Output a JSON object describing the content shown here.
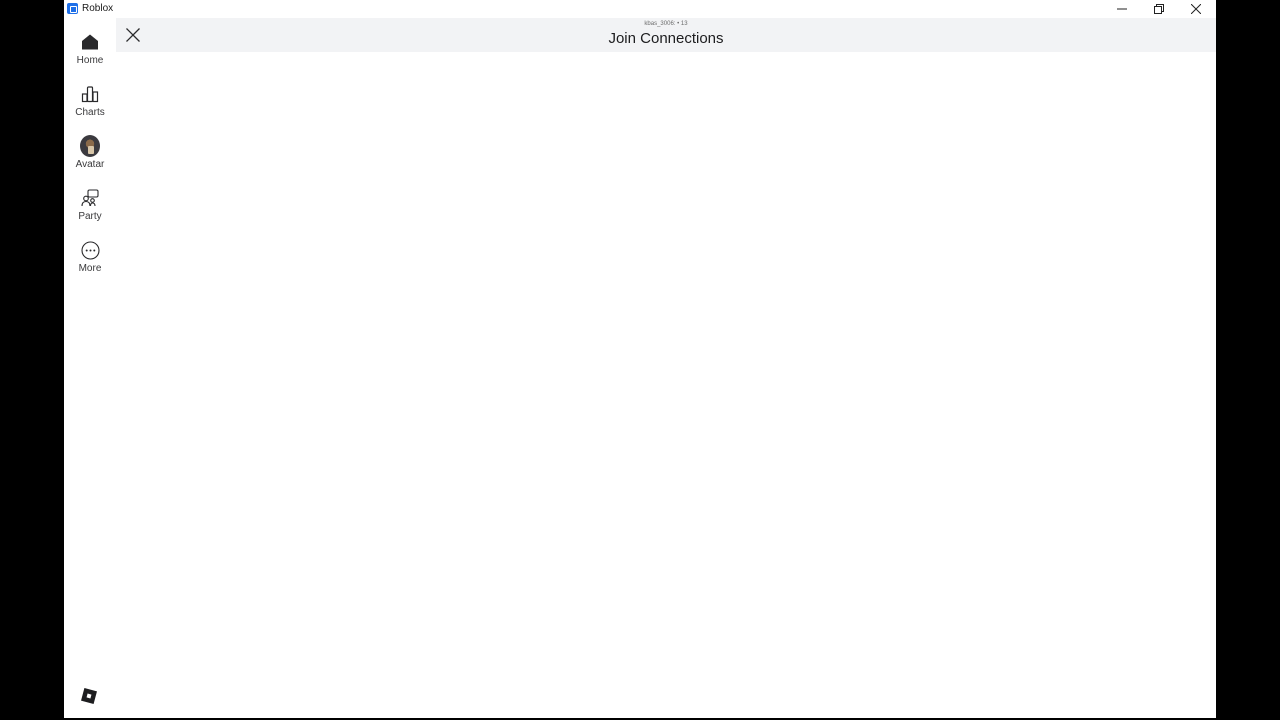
{
  "window": {
    "title": "Roblox"
  },
  "sidebar": {
    "items": [
      {
        "label": "Home",
        "icon": "home-icon"
      },
      {
        "label": "Charts",
        "icon": "charts-icon"
      },
      {
        "label": "Avatar",
        "icon": "avatar-icon"
      },
      {
        "label": "Party",
        "icon": "party-icon"
      },
      {
        "label": "More",
        "icon": "more-icon"
      }
    ]
  },
  "header": {
    "subtitle": "kbas_3006: • 13",
    "title": "Join Connections"
  },
  "colors": {
    "accent": "#1e6fe8",
    "header_bg": "#f2f3f5",
    "text": "#39393b"
  }
}
